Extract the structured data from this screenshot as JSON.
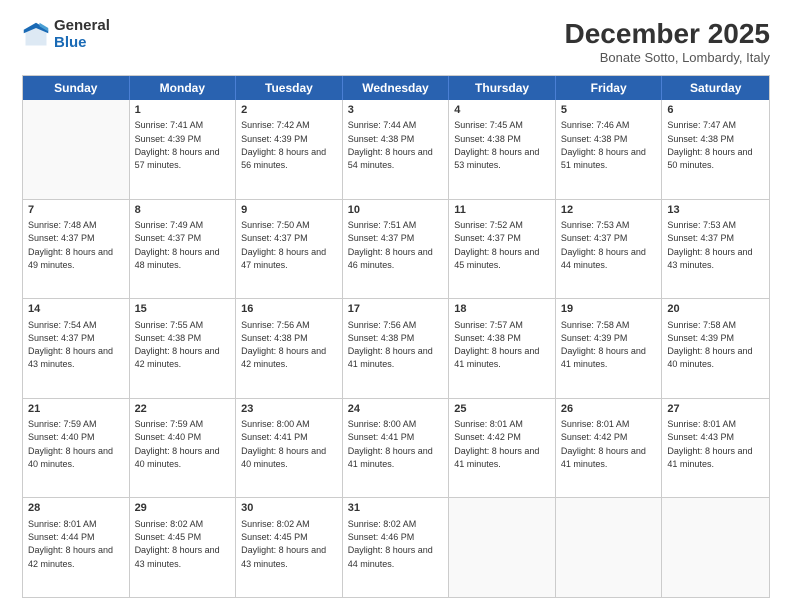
{
  "logo": {
    "general": "General",
    "blue": "Blue"
  },
  "header": {
    "month": "December 2025",
    "location": "Bonate Sotto, Lombardy, Italy"
  },
  "weekdays": [
    "Sunday",
    "Monday",
    "Tuesday",
    "Wednesday",
    "Thursday",
    "Friday",
    "Saturday"
  ],
  "weeks": [
    [
      {
        "day": "",
        "sunrise": "",
        "sunset": "",
        "daylight": ""
      },
      {
        "day": "1",
        "sunrise": "Sunrise: 7:41 AM",
        "sunset": "Sunset: 4:39 PM",
        "daylight": "Daylight: 8 hours and 57 minutes."
      },
      {
        "day": "2",
        "sunrise": "Sunrise: 7:42 AM",
        "sunset": "Sunset: 4:39 PM",
        "daylight": "Daylight: 8 hours and 56 minutes."
      },
      {
        "day": "3",
        "sunrise": "Sunrise: 7:44 AM",
        "sunset": "Sunset: 4:38 PM",
        "daylight": "Daylight: 8 hours and 54 minutes."
      },
      {
        "day": "4",
        "sunrise": "Sunrise: 7:45 AM",
        "sunset": "Sunset: 4:38 PM",
        "daylight": "Daylight: 8 hours and 53 minutes."
      },
      {
        "day": "5",
        "sunrise": "Sunrise: 7:46 AM",
        "sunset": "Sunset: 4:38 PM",
        "daylight": "Daylight: 8 hours and 51 minutes."
      },
      {
        "day": "6",
        "sunrise": "Sunrise: 7:47 AM",
        "sunset": "Sunset: 4:38 PM",
        "daylight": "Daylight: 8 hours and 50 minutes."
      }
    ],
    [
      {
        "day": "7",
        "sunrise": "Sunrise: 7:48 AM",
        "sunset": "Sunset: 4:37 PM",
        "daylight": "Daylight: 8 hours and 49 minutes."
      },
      {
        "day": "8",
        "sunrise": "Sunrise: 7:49 AM",
        "sunset": "Sunset: 4:37 PM",
        "daylight": "Daylight: 8 hours and 48 minutes."
      },
      {
        "day": "9",
        "sunrise": "Sunrise: 7:50 AM",
        "sunset": "Sunset: 4:37 PM",
        "daylight": "Daylight: 8 hours and 47 minutes."
      },
      {
        "day": "10",
        "sunrise": "Sunrise: 7:51 AM",
        "sunset": "Sunset: 4:37 PM",
        "daylight": "Daylight: 8 hours and 46 minutes."
      },
      {
        "day": "11",
        "sunrise": "Sunrise: 7:52 AM",
        "sunset": "Sunset: 4:37 PM",
        "daylight": "Daylight: 8 hours and 45 minutes."
      },
      {
        "day": "12",
        "sunrise": "Sunrise: 7:53 AM",
        "sunset": "Sunset: 4:37 PM",
        "daylight": "Daylight: 8 hours and 44 minutes."
      },
      {
        "day": "13",
        "sunrise": "Sunrise: 7:53 AM",
        "sunset": "Sunset: 4:37 PM",
        "daylight": "Daylight: 8 hours and 43 minutes."
      }
    ],
    [
      {
        "day": "14",
        "sunrise": "Sunrise: 7:54 AM",
        "sunset": "Sunset: 4:37 PM",
        "daylight": "Daylight: 8 hours and 43 minutes."
      },
      {
        "day": "15",
        "sunrise": "Sunrise: 7:55 AM",
        "sunset": "Sunset: 4:38 PM",
        "daylight": "Daylight: 8 hours and 42 minutes."
      },
      {
        "day": "16",
        "sunrise": "Sunrise: 7:56 AM",
        "sunset": "Sunset: 4:38 PM",
        "daylight": "Daylight: 8 hours and 42 minutes."
      },
      {
        "day": "17",
        "sunrise": "Sunrise: 7:56 AM",
        "sunset": "Sunset: 4:38 PM",
        "daylight": "Daylight: 8 hours and 41 minutes."
      },
      {
        "day": "18",
        "sunrise": "Sunrise: 7:57 AM",
        "sunset": "Sunset: 4:38 PM",
        "daylight": "Daylight: 8 hours and 41 minutes."
      },
      {
        "day": "19",
        "sunrise": "Sunrise: 7:58 AM",
        "sunset": "Sunset: 4:39 PM",
        "daylight": "Daylight: 8 hours and 41 minutes."
      },
      {
        "day": "20",
        "sunrise": "Sunrise: 7:58 AM",
        "sunset": "Sunset: 4:39 PM",
        "daylight": "Daylight: 8 hours and 40 minutes."
      }
    ],
    [
      {
        "day": "21",
        "sunrise": "Sunrise: 7:59 AM",
        "sunset": "Sunset: 4:40 PM",
        "daylight": "Daylight: 8 hours and 40 minutes."
      },
      {
        "day": "22",
        "sunrise": "Sunrise: 7:59 AM",
        "sunset": "Sunset: 4:40 PM",
        "daylight": "Daylight: 8 hours and 40 minutes."
      },
      {
        "day": "23",
        "sunrise": "Sunrise: 8:00 AM",
        "sunset": "Sunset: 4:41 PM",
        "daylight": "Daylight: 8 hours and 40 minutes."
      },
      {
        "day": "24",
        "sunrise": "Sunrise: 8:00 AM",
        "sunset": "Sunset: 4:41 PM",
        "daylight": "Daylight: 8 hours and 41 minutes."
      },
      {
        "day": "25",
        "sunrise": "Sunrise: 8:01 AM",
        "sunset": "Sunset: 4:42 PM",
        "daylight": "Daylight: 8 hours and 41 minutes."
      },
      {
        "day": "26",
        "sunrise": "Sunrise: 8:01 AM",
        "sunset": "Sunset: 4:42 PM",
        "daylight": "Daylight: 8 hours and 41 minutes."
      },
      {
        "day": "27",
        "sunrise": "Sunrise: 8:01 AM",
        "sunset": "Sunset: 4:43 PM",
        "daylight": "Daylight: 8 hours and 41 minutes."
      }
    ],
    [
      {
        "day": "28",
        "sunrise": "Sunrise: 8:01 AM",
        "sunset": "Sunset: 4:44 PM",
        "daylight": "Daylight: 8 hours and 42 minutes."
      },
      {
        "day": "29",
        "sunrise": "Sunrise: 8:02 AM",
        "sunset": "Sunset: 4:45 PM",
        "daylight": "Daylight: 8 hours and 43 minutes."
      },
      {
        "day": "30",
        "sunrise": "Sunrise: 8:02 AM",
        "sunset": "Sunset: 4:45 PM",
        "daylight": "Daylight: 8 hours and 43 minutes."
      },
      {
        "day": "31",
        "sunrise": "Sunrise: 8:02 AM",
        "sunset": "Sunset: 4:46 PM",
        "daylight": "Daylight: 8 hours and 44 minutes."
      },
      {
        "day": "",
        "sunrise": "",
        "sunset": "",
        "daylight": ""
      },
      {
        "day": "",
        "sunrise": "",
        "sunset": "",
        "daylight": ""
      },
      {
        "day": "",
        "sunrise": "",
        "sunset": "",
        "daylight": ""
      }
    ]
  ]
}
